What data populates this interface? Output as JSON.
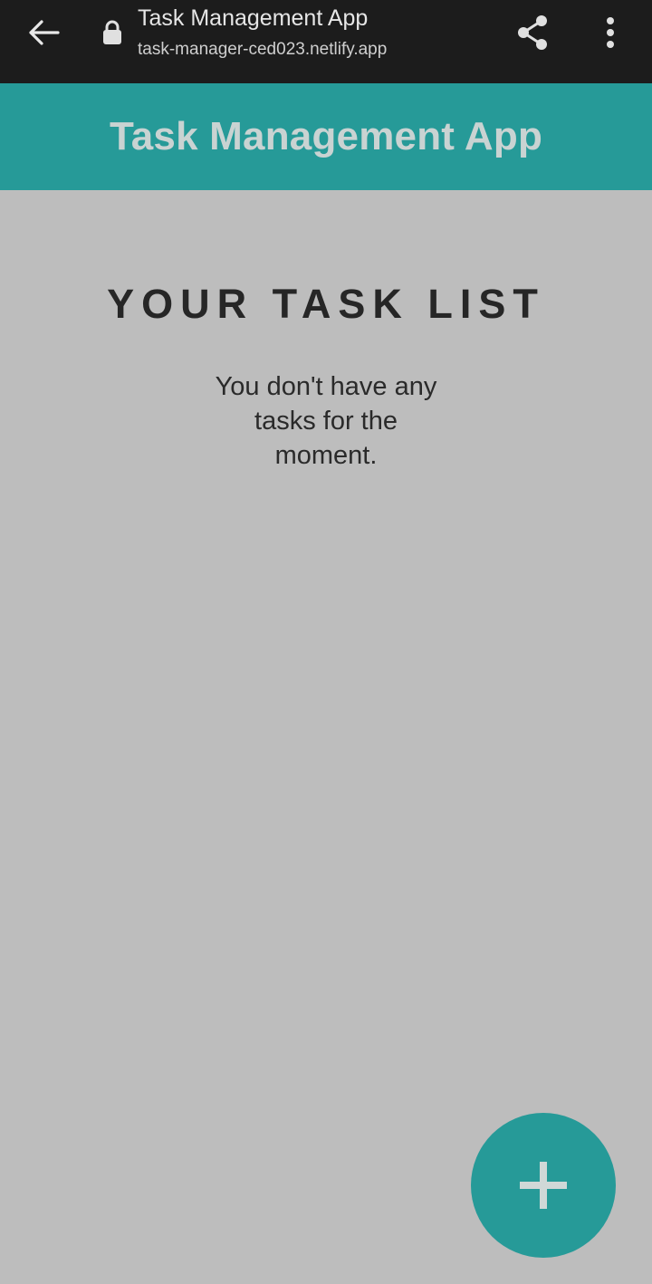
{
  "browser": {
    "tab_title": "Task Management App",
    "url": "task-manager-ced023.netlify.app",
    "back_icon": "arrow-left-icon",
    "lock_icon": "lock-icon",
    "share_icon": "share-icon",
    "more_icon": "more-vert-icon"
  },
  "header": {
    "title": "Task Management App",
    "color": "#269a98"
  },
  "main": {
    "list_title": "YOUR TASK LIST",
    "empty_message": "You don't have any tasks for the moment."
  },
  "fab": {
    "icon": "plus-icon",
    "color": "#269a98"
  }
}
